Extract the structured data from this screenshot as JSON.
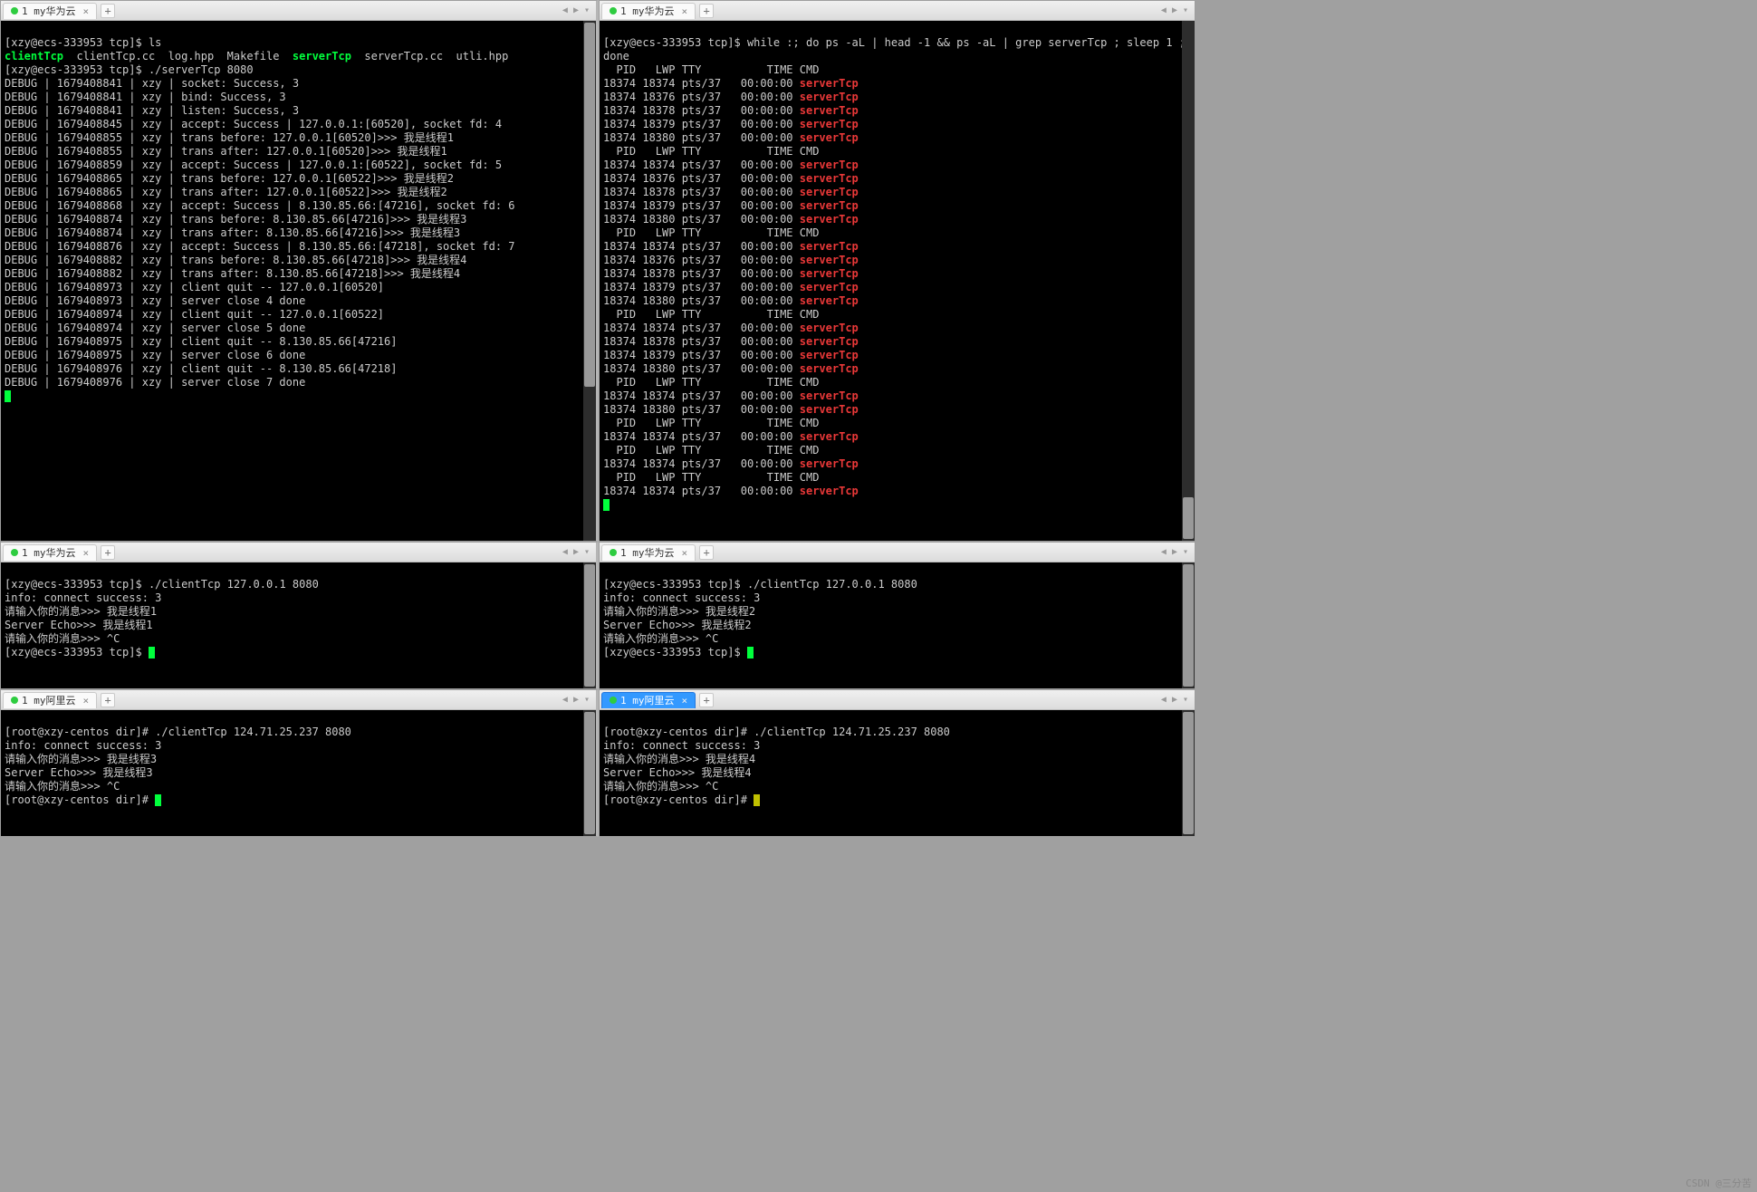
{
  "watermark": "CSDN @三分苦",
  "panes": {
    "tl": {
      "tab": "1 my华为云"
    },
    "tr": {
      "tab": "1 my华为云"
    },
    "ml": {
      "tab": "1 my华为云"
    },
    "mr": {
      "tab": "1 my华为云"
    },
    "bl": {
      "tab": "1 my阿里云"
    },
    "br": {
      "tab": "1 my阿里云"
    }
  },
  "tl_prompt1": "[xzy@ecs-333953 tcp]$ ",
  "tl_cmd1": "ls",
  "tl_ls": {
    "clientTcp": "clientTcp",
    "cc": "  clientTcp.cc  log.hpp  Makefile  ",
    "serverTcp": "serverTcp",
    "rest": "  serverTcp.cc  utli.hpp"
  },
  "tl_prompt2": "[xzy@ecs-333953 tcp]$ ",
  "tl_cmd2": "./serverTcp 8080",
  "tl_lines": [
    "DEBUG | 1679408841 | xzy | socket: Success, 3",
    "DEBUG | 1679408841 | xzy | bind: Success, 3",
    "DEBUG | 1679408841 | xzy | listen: Success, 3",
    "DEBUG | 1679408845 | xzy | accept: Success | 127.0.0.1:[60520], socket fd: 4",
    "DEBUG | 1679408855 | xzy | trans before: 127.0.0.1[60520]>>> 我是线程1",
    "DEBUG | 1679408855 | xzy | trans after: 127.0.0.1[60520]>>> 我是线程1",
    "DEBUG | 1679408859 | xzy | accept: Success | 127.0.0.1:[60522], socket fd: 5",
    "DEBUG | 1679408865 | xzy | trans before: 127.0.0.1[60522]>>> 我是线程2",
    "DEBUG | 1679408865 | xzy | trans after: 127.0.0.1[60522]>>> 我是线程2",
    "DEBUG | 1679408868 | xzy | accept: Success | 8.130.85.66:[47216], socket fd: 6",
    "DEBUG | 1679408874 | xzy | trans before: 8.130.85.66[47216]>>> 我是线程3",
    "DEBUG | 1679408874 | xzy | trans after: 8.130.85.66[47216]>>> 我是线程3",
    "DEBUG | 1679408876 | xzy | accept: Success | 8.130.85.66:[47218], socket fd: 7",
    "DEBUG | 1679408882 | xzy | trans before: 8.130.85.66[47218]>>> 我是线程4",
    "DEBUG | 1679408882 | xzy | trans after: 8.130.85.66[47218]>>> 我是线程4",
    "DEBUG | 1679408973 | xzy | client quit -- 127.0.0.1[60520]",
    "DEBUG | 1679408973 | xzy | server close 4 done",
    "DEBUG | 1679408974 | xzy | client quit -- 127.0.0.1[60522]",
    "DEBUG | 1679408974 | xzy | server close 5 done",
    "DEBUG | 1679408975 | xzy | client quit -- 8.130.85.66[47216]",
    "DEBUG | 1679408975 | xzy | server close 6 done",
    "DEBUG | 1679408976 | xzy | client quit -- 8.130.85.66[47218]",
    "DEBUG | 1679408976 | xzy | server close 7 done"
  ],
  "tr_prompt": "[xzy@ecs-333953 tcp]$ ",
  "tr_cmd": "while :; do ps -aL | head -1 && ps -aL | grep serverTcp ; sleep 1 ;",
  "tr_cmd2": "done",
  "tr_header": "  PID   LWP TTY          TIME CMD",
  "tr_rows": [
    "18374 18374 pts/37   00:00:00 ",
    "18374 18376 pts/37   00:00:00 ",
    "18374 18378 pts/37   00:00:00 ",
    "18374 18379 pts/37   00:00:00 ",
    "18374 18380 pts/37   00:00:00 "
  ],
  "tr_rows_b": [
    "18374 18374 pts/37   00:00:00 ",
    "18374 18380 pts/37   00:00:00 "
  ],
  "tr_rows_c": [
    "18374 18374 pts/37   00:00:00 "
  ],
  "tr_proc": "serverTcp",
  "ml": {
    "prompt": "[xzy@ecs-333953 tcp]$ ",
    "cmd": "./clientTcp 127.0.0.1 8080",
    "l1": "info: connect success: 3",
    "l2": "请输入你的消息>>> 我是线程1",
    "l3": "Server Echo>>> 我是线程1",
    "l4": "请输入你的消息>>> ^C",
    "p2": "[xzy@ecs-333953 tcp]$ "
  },
  "mr": {
    "prompt": "[xzy@ecs-333953 tcp]$ ",
    "cmd": "./clientTcp 127.0.0.1 8080",
    "l1": "info: connect success: 3",
    "l2": "请输入你的消息>>> 我是线程2",
    "l3": "Server Echo>>> 我是线程2",
    "l4": "请输入你的消息>>> ^C",
    "p2": "[xzy@ecs-333953 tcp]$ "
  },
  "bl": {
    "prompt": "[root@xzy-centos dir]# ",
    "cmd": "./clientTcp 124.71.25.237 8080",
    "l1": "info: connect success: 3",
    "l2": "请输入你的消息>>> 我是线程3",
    "l3": "Server Echo>>> 我是线程3",
    "l4": "请输入你的消息>>> ^C",
    "p2": "[root@xzy-centos dir]# "
  },
  "br": {
    "prompt": "[root@xzy-centos dir]# ",
    "cmd": "./clientTcp 124.71.25.237 8080",
    "l1": "info: connect success: 3",
    "l2": "请输入你的消息>>> 我是线程4",
    "l3": "Server Echo>>> 我是线程4",
    "l4": "请输入你的消息>>> ^C",
    "p2": "[root@xzy-centos dir]# "
  }
}
